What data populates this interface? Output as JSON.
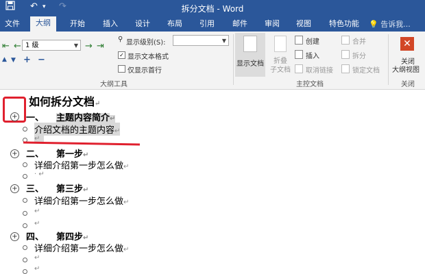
{
  "titlebar": {
    "undo_icon": "undo-arrow",
    "redo_icon": "redo-arrow",
    "window_title": "拆分文档 - Word"
  },
  "tabs": [
    "文件",
    "大纲",
    "开始",
    "插入",
    "设计",
    "布局",
    "引用",
    "邮件",
    "审阅",
    "视图",
    "特色功能"
  ],
  "tell_me": "告诉我...",
  "outline_tools": {
    "level_value": "1 级",
    "show_level_label": "显示级别(S):",
    "show_text_format": "显示文本格式",
    "show_first_line": "仅显示首行",
    "group_label": "大纲工具"
  },
  "master_doc": {
    "show_doc": "显示文档",
    "collapse_line1": "折叠",
    "collapse_line2": "子文档",
    "create": "创建",
    "insert": "插入",
    "unlink": "取消链接",
    "merge": "合并",
    "split": "拆分",
    "lock": "锁定文档",
    "group_label": "主控文档"
  },
  "close_group": {
    "line1": "关闭",
    "line2": "大纲视图",
    "group_label": "关闭"
  },
  "document": {
    "title": "如何拆分文档",
    "h1_num": "一、",
    "h1_text": "主题内容简介",
    "b1": "介绍文档的主题内容",
    "h2_num": "二、",
    "h2_text": "第一步",
    "b2": "详细介绍第一步怎么做",
    "h3_num": "三、",
    "h3_text": "第三步",
    "b3": "详细介绍第一步怎么做",
    "h4_num": "四、",
    "h4_text": "第四步",
    "b4": "详细介绍第一步怎么做",
    "para_mark": "↵"
  },
  "colors": {
    "title_bar": "#2b579a",
    "ribbon": "#f3f3f3",
    "annotation": "#e0202e"
  }
}
